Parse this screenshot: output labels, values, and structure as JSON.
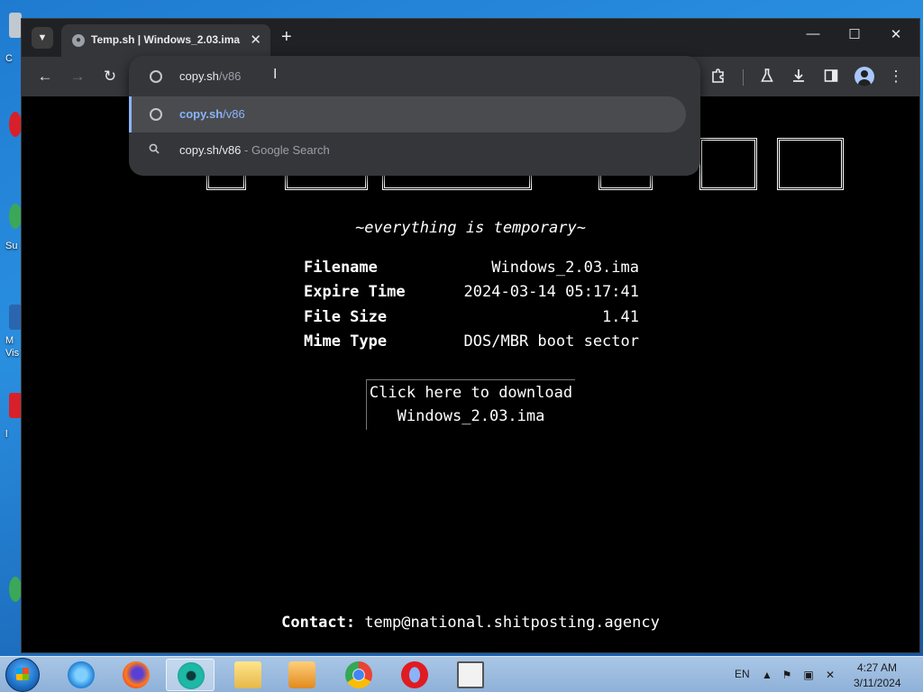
{
  "desktop": {
    "icons": [
      {
        "name": "recycle-bin",
        "label": "C",
        "color": "#c0c8d0"
      },
      {
        "name": "opera",
        "label": "",
        "color": "#d8202a"
      },
      {
        "name": "sumatra",
        "label": "Su",
        "color": "#3aa858"
      },
      {
        "name": "media",
        "label": "M",
        "color": "#2a66b0"
      },
      {
        "name": "visual",
        "label": "Vis",
        "color": "#3070b8"
      },
      {
        "name": "misc",
        "label": "l",
        "color": "#d8202a"
      },
      {
        "name": "misc2",
        "label": "",
        "color": "#3aa858"
      }
    ]
  },
  "browser": {
    "tab_title": "Temp.sh | Windows_2.03.ima",
    "tab_close": "✕",
    "new_tab": "+",
    "window_controls": {
      "minimize": "—",
      "maximize": "☐",
      "close": "✕"
    },
    "toolbar": {
      "back": "←",
      "forward": "→",
      "reload": "↻"
    },
    "toolbar_right": {
      "extensions": "extensions-icon",
      "labs": "flask-icon",
      "downloads": "download-icon",
      "sidepanel": "side-panel-icon",
      "profile": "profile-icon",
      "menu": "⋮"
    },
    "omnibox": {
      "input_domain": "copy.sh",
      "input_path": "/v86",
      "suggestions": [
        {
          "text_domain": "copy.sh",
          "text_path": "/v86",
          "type": "url",
          "selected": true
        },
        {
          "text": "copy.sh/v86",
          "hint": " - Google Search",
          "type": "search",
          "selected": false
        }
      ]
    },
    "colors": {
      "accent": "#8ab4f8",
      "titlebar": "#202124",
      "toolbar": "#35363a"
    }
  },
  "page": {
    "tagline": "~everything is temporary~",
    "fields": [
      {
        "label": "Filename",
        "value": "Windows_2.03.ima"
      },
      {
        "label": "Expire Time",
        "value": "2024-03-14 05:17:41"
      },
      {
        "label": "File Size",
        "value": "1.41"
      },
      {
        "label": "Mime Type",
        "value": "DOS/MBR boot sector"
      }
    ],
    "download_line1": "Click here to download",
    "download_line2": "Windows_2.03.ima",
    "contact_label": "Contact:",
    "contact_email": "temp@national.shitposting.agency"
  },
  "taskbar": {
    "apps": [
      {
        "name": "internet-explorer",
        "active": false
      },
      {
        "name": "firefox",
        "active": false
      },
      {
        "name": "chrome-beta",
        "active": true
      },
      {
        "name": "explorer",
        "active": false
      },
      {
        "name": "media-player",
        "active": false
      },
      {
        "name": "chrome",
        "active": false
      },
      {
        "name": "opera",
        "active": false
      },
      {
        "name": "app-window",
        "active": false
      }
    ],
    "language": "EN",
    "time": "4:27 AM",
    "date": "3/11/2024"
  }
}
